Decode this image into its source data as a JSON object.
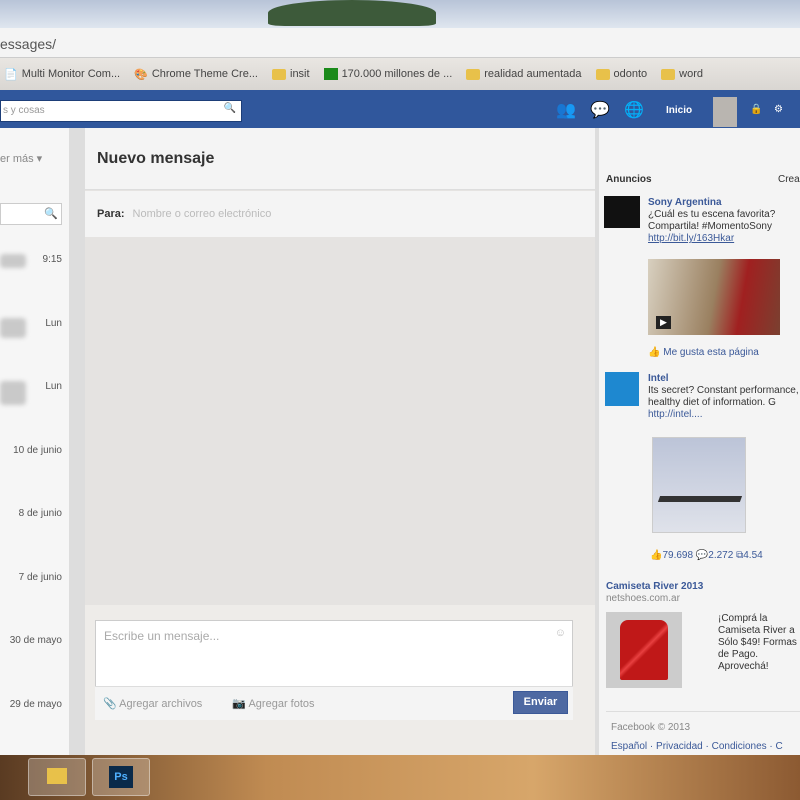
{
  "browser": {
    "address": "essages/",
    "bookmarks": [
      "Multi Monitor Com...",
      "Chrome Theme Cre...",
      "insit",
      "170.000 millones de ...",
      "realidad aumentada",
      "odonto",
      "word"
    ]
  },
  "topbar": {
    "search_placeholder": "s y cosas",
    "home": "Inicio"
  },
  "left": {
    "more": "er más ▾",
    "timestamps": [
      "9:15",
      "Lun",
      "Lun",
      "10 de junio",
      "8 de junio",
      "7 de junio",
      "30 de mayo",
      "29 de mayo"
    ]
  },
  "compose": {
    "title": "Nuevo mensaje",
    "to_label": "Para:",
    "to_placeholder": "Nombre o correo electrónico",
    "message_placeholder": "Escribe un mensaje...",
    "attach_file": "Agregar archivos",
    "attach_photo": "Agregar fotos",
    "send": "Enviar"
  },
  "ads": {
    "header": "Anuncios",
    "create": "Crear",
    "items": [
      {
        "title": "Sony Argentina",
        "text": "¿Cuál es tu escena favorita? Compartila! #MomentoSony",
        "link": "http://bit.ly/163Hkar",
        "like": "Me gusta esta página"
      },
      {
        "title": "Intel",
        "text": "Its secret? Constant performance, a healthy diet of information. G",
        "link": "http://intel....",
        "likes": "79.698",
        "comments": "2.272",
        "shares": "4.54"
      },
      {
        "title": "Camiseta River 2013",
        "domain": "netshoes.com.ar",
        "text": "¡Comprá la Camiseta River a Sólo $49! Formas de Pago. Aprovechá!"
      }
    ]
  },
  "footer": {
    "copyright": "Facebook © 2013",
    "links": "Español · Privacidad · Condiciones · C"
  },
  "taskbar": {
    "ps": "Ps"
  }
}
